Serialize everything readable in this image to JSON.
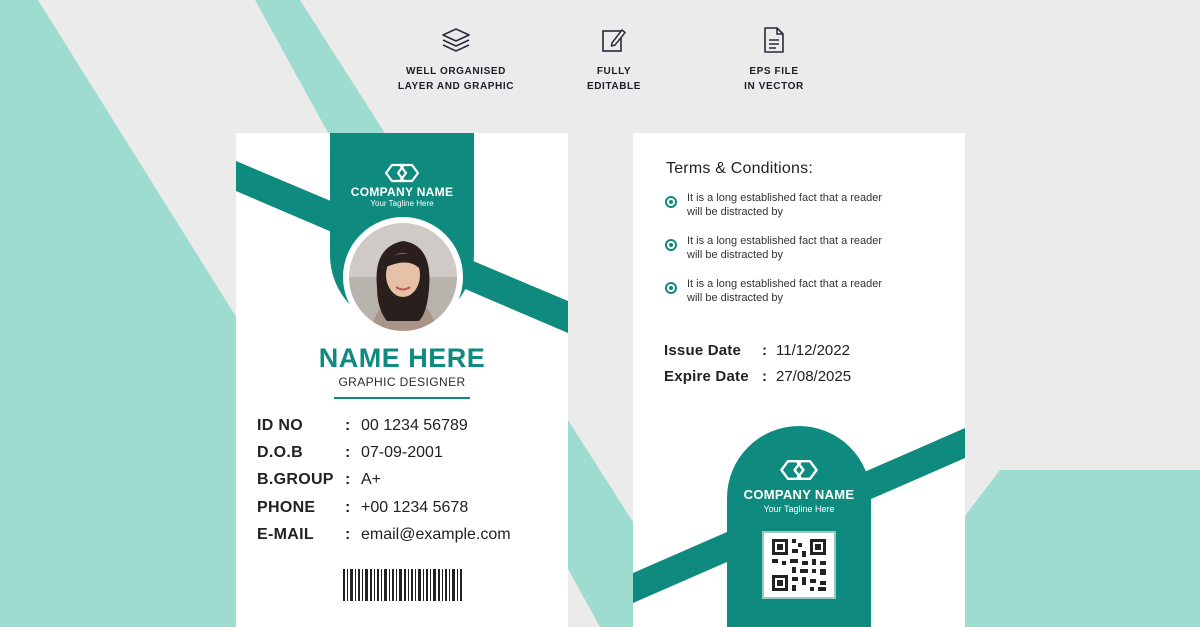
{
  "features": [
    {
      "icon": "layers-icon",
      "label": "WELL ORGANISED\nLAYER AND GRAPHIC"
    },
    {
      "icon": "edit-icon",
      "label": "FULLY\nEDITABLE"
    },
    {
      "icon": "document-icon",
      "label": "EPS FILE\nIN VECTOR"
    }
  ],
  "front": {
    "company_name": "COMPANY NAME",
    "tagline": "Your Tagline Here",
    "holder_name": "NAME HERE",
    "holder_role": "GRAPHIC DESIGNER",
    "fields": [
      {
        "label": "ID NO",
        "value": "00 1234 56789"
      },
      {
        "label": "D.O.B",
        "value": "07-09-2001"
      },
      {
        "label": "B.GROUP",
        "value": "A+"
      },
      {
        "label": "PHONE",
        "value": "+00 1234 5678"
      },
      {
        "label": "E-MAIL",
        "value": "email@example.com"
      }
    ],
    "colon": ":"
  },
  "back": {
    "terms_title": "Terms & Conditions:",
    "terms": [
      "It is a long established fact that a reader\nwill be distracted by",
      "It is a long established fact that a reader\nwill be distracted by",
      "It is a long established fact that a reader\nwill be distracted by"
    ],
    "issue_label": "Issue Date",
    "issue_value": "11/12/2022",
    "expire_label": "Expire Date",
    "expire_value": "27/08/2025",
    "colon": ":",
    "company_name": "COMPANY NAME",
    "tagline": "Your Tagline Here"
  },
  "colors": {
    "teal": "#0f8a7f",
    "mint": "#9fdcd0",
    "background": "#ebebeb"
  }
}
